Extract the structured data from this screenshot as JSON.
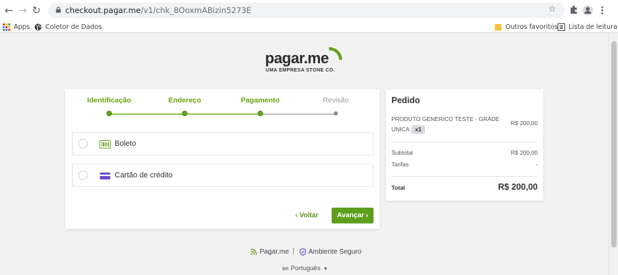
{
  "browser": {
    "url_host": "checkout.pagar.me",
    "url_path": "/v1/chk_8OoxmABizin5273E",
    "bookmarks": {
      "apps": "Apps",
      "coletor": "Coletor de Dados",
      "outros": "Outros favoritos",
      "lista": "Lista de leitura"
    }
  },
  "brand": {
    "logo": "pagar.me",
    "tagline": "UMA EMPRESA STONE CO.",
    "accent": "#5e9e1d"
  },
  "steps": [
    {
      "label": "Identificação",
      "state": "done"
    },
    {
      "label": "Endereço",
      "state": "done"
    },
    {
      "label": "Pagamento",
      "state": "active"
    },
    {
      "label": "Revisão",
      "state": "pending"
    }
  ],
  "payment_methods": [
    {
      "label": "Boleto",
      "icon": "barcode-icon"
    },
    {
      "label": "Cartão de crédito",
      "icon": "credit-card-icon"
    }
  ],
  "actions": {
    "back": "Voltar",
    "next": "Avançar"
  },
  "order": {
    "title": "Pedido",
    "product_name": "PRODUTO GENERICO TESTE - GRADE UNICA",
    "quantity": "x1",
    "product_price": "R$ 200,00",
    "subtotal_label": "Subtotal",
    "subtotal_value": "R$ 200,00",
    "fees_label": "Tarifas",
    "fees_value": "-",
    "total_label": "Total",
    "total_value": "R$ 200,00"
  },
  "footer": {
    "brand": "Pagar.me",
    "separator": "|",
    "secure": "Ambiente Seguro",
    "lang_code": "BR",
    "language": "Português"
  }
}
